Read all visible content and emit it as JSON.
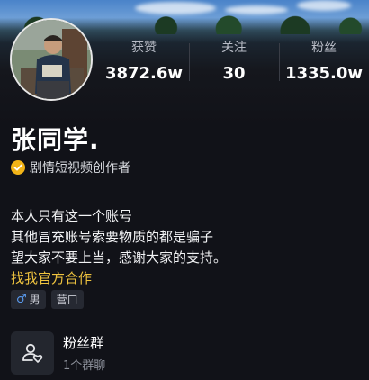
{
  "profile": {
    "name": "张同学.",
    "verified_label": "剧情短视频创作者"
  },
  "stats": [
    {
      "label": "获赞",
      "value": "3872.6w"
    },
    {
      "label": "关注",
      "value": "30"
    },
    {
      "label": "粉丝",
      "value": "1335.0w"
    }
  ],
  "bio": {
    "lines": [
      "本人只有这一个账号",
      "其他冒充账号索要物质的都是骗子",
      "望大家不要上当，感谢大家的支持。"
    ],
    "link": "找我官方合作"
  },
  "tags": {
    "gender_icon": "♂",
    "gender": "男",
    "location": "营口"
  },
  "fan_group": {
    "title": "粉丝群",
    "subtitle": "1个群聊"
  },
  "colors": {
    "background": "#111218",
    "link": "#f0c43f",
    "verified_badge": "#f2b418",
    "gender_icon": "#5a9cf2"
  }
}
